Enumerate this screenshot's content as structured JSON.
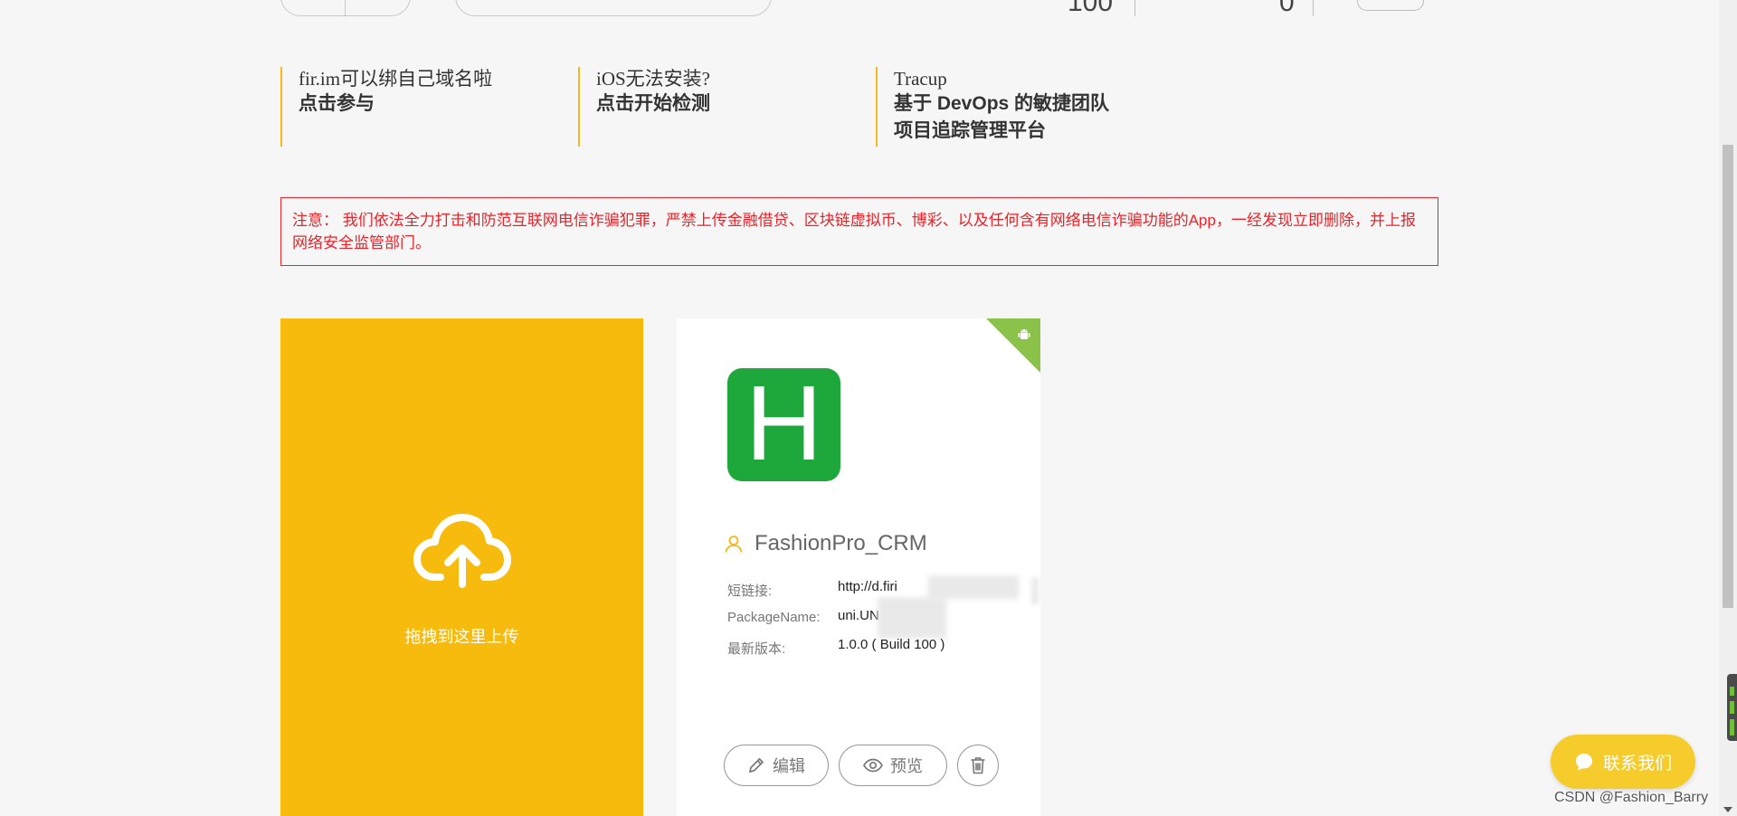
{
  "top_bar": {
    "stat_left": "100",
    "stat_right": "0",
    "more_label": "· ·"
  },
  "promos": [
    {
      "title": "fir.im可以绑自己域名啦",
      "lines": [
        "点击参与"
      ]
    },
    {
      "title": "iOS无法安装?",
      "lines": [
        "点击开始检测"
      ]
    },
    {
      "title": "Tracup",
      "lines": [
        "基于 DevOps 的敏捷团队",
        "项目追踪管理平台"
      ]
    }
  ],
  "notice": {
    "text": "注意： 我们依法全力打击和防范互联网电信诈骗犯罪，严禁上传金融借贷、区块链虚拟币、博彩、以及任何含有网络电信诈骗功能的App，一经发现立即删除，并上报网络安全监管部门。"
  },
  "upload": {
    "label": "拖拽到这里上传"
  },
  "app_card": {
    "logo_letter": "H",
    "name": "FashionPro_CRM",
    "fields": [
      {
        "label": "短链接:",
        "value": "http://d.firi"
      },
      {
        "label": "PackageName:",
        "value": "uni.UN"
      },
      {
        "label": "最新版本:",
        "value": "1.0.0 ( Build 100 )"
      }
    ],
    "actions": {
      "edit": "编辑",
      "preview": "预览"
    }
  },
  "contact": {
    "label": "联系我们"
  },
  "watermark": "CSDN @Fashion_Barry",
  "colors": {
    "accent": "#f7bb0e",
    "notice_red": "#e8232a",
    "app_green": "#1ea83c",
    "android_green": "#8bc34a"
  }
}
